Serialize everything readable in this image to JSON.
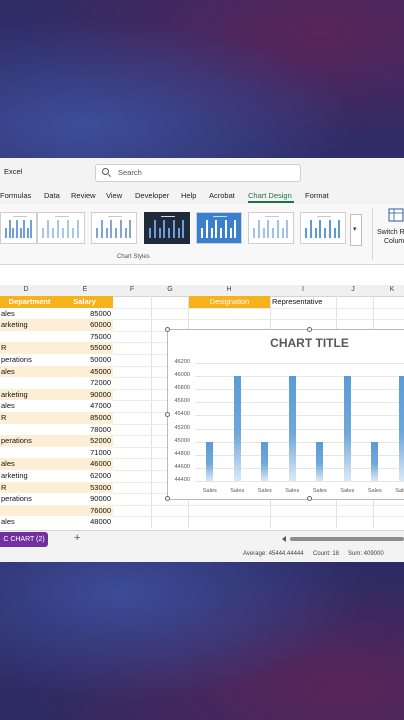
{
  "app": {
    "name": "Excel",
    "search_placeholder": "Search"
  },
  "menu": {
    "tabs": [
      "Formulas",
      "Data",
      "Review",
      "View",
      "Developer",
      "Help",
      "Acrobat",
      "Chart Design",
      "Format"
    ],
    "active": "Chart Design"
  },
  "ribbon": {
    "group_label": "Chart Styles",
    "switch_label_line1": "Switch R",
    "switch_label_line2": "Colum",
    "more_glyph": "▾",
    "style_count": 8
  },
  "columns": [
    "D",
    "E",
    "F",
    "G",
    "H",
    "I",
    "J",
    "K"
  ],
  "table": {
    "headers": {
      "department": "Department",
      "salary": "Salary"
    },
    "rows": [
      {
        "department": "ales",
        "salary": "85000"
      },
      {
        "department": "arketing",
        "salary": "60000"
      },
      {
        "department": "",
        "salary": "75000"
      },
      {
        "department": "R",
        "salary": "55000"
      },
      {
        "department": "perations",
        "salary": "50000"
      },
      {
        "department": "ales",
        "salary": "45000"
      },
      {
        "department": "",
        "salary": "72000"
      },
      {
        "department": "arketing",
        "salary": "90000"
      },
      {
        "department": "ales",
        "salary": "47000"
      },
      {
        "department": "R",
        "salary": "85000"
      },
      {
        "department": "",
        "salary": "78000"
      },
      {
        "department": "perations",
        "salary": "52000"
      },
      {
        "department": "",
        "salary": "71000"
      },
      {
        "department": "ales",
        "salary": "46000"
      },
      {
        "department": "arketing",
        "salary": "62000"
      },
      {
        "department": "R",
        "salary": "53000"
      },
      {
        "department": "perations",
        "salary": "90000"
      },
      {
        "department": "",
        "salary": "76000"
      },
      {
        "department": "ales",
        "salary": "48000"
      }
    ],
    "designation_header": "Designation",
    "representative_cell": "Representative"
  },
  "chart_data": {
    "type": "bar",
    "title": "CHART TITLE",
    "categories": [
      "Sales",
      "Sales",
      "Sales",
      "Sales",
      "Sales",
      "Sales",
      "Sales",
      "Sales"
    ],
    "series": [
      {
        "values": [
          45000,
          46000,
          45000,
          46000,
          45000,
          46000,
          45000,
          46000
        ]
      }
    ],
    "ylim": [
      44400,
      46200
    ],
    "yticks": [
      44400,
      44600,
      44800,
      45000,
      45200,
      45400,
      45600,
      45800,
      46000,
      46200
    ],
    "colors": {
      "bar": "#5b9bd5"
    },
    "legend": "none",
    "grid": true
  },
  "sheet": {
    "tab_label": "C CHART (2)",
    "add_glyph": "+"
  },
  "status": {
    "average": "Average: 45444.44444",
    "count": "Count: 18",
    "sum": "Sum: 409000"
  },
  "colors": {
    "accent_header": "#f5b21a",
    "shade": "#fcefd6",
    "sheet_tab": "#7030a0",
    "active_tab": "#1e7145"
  }
}
